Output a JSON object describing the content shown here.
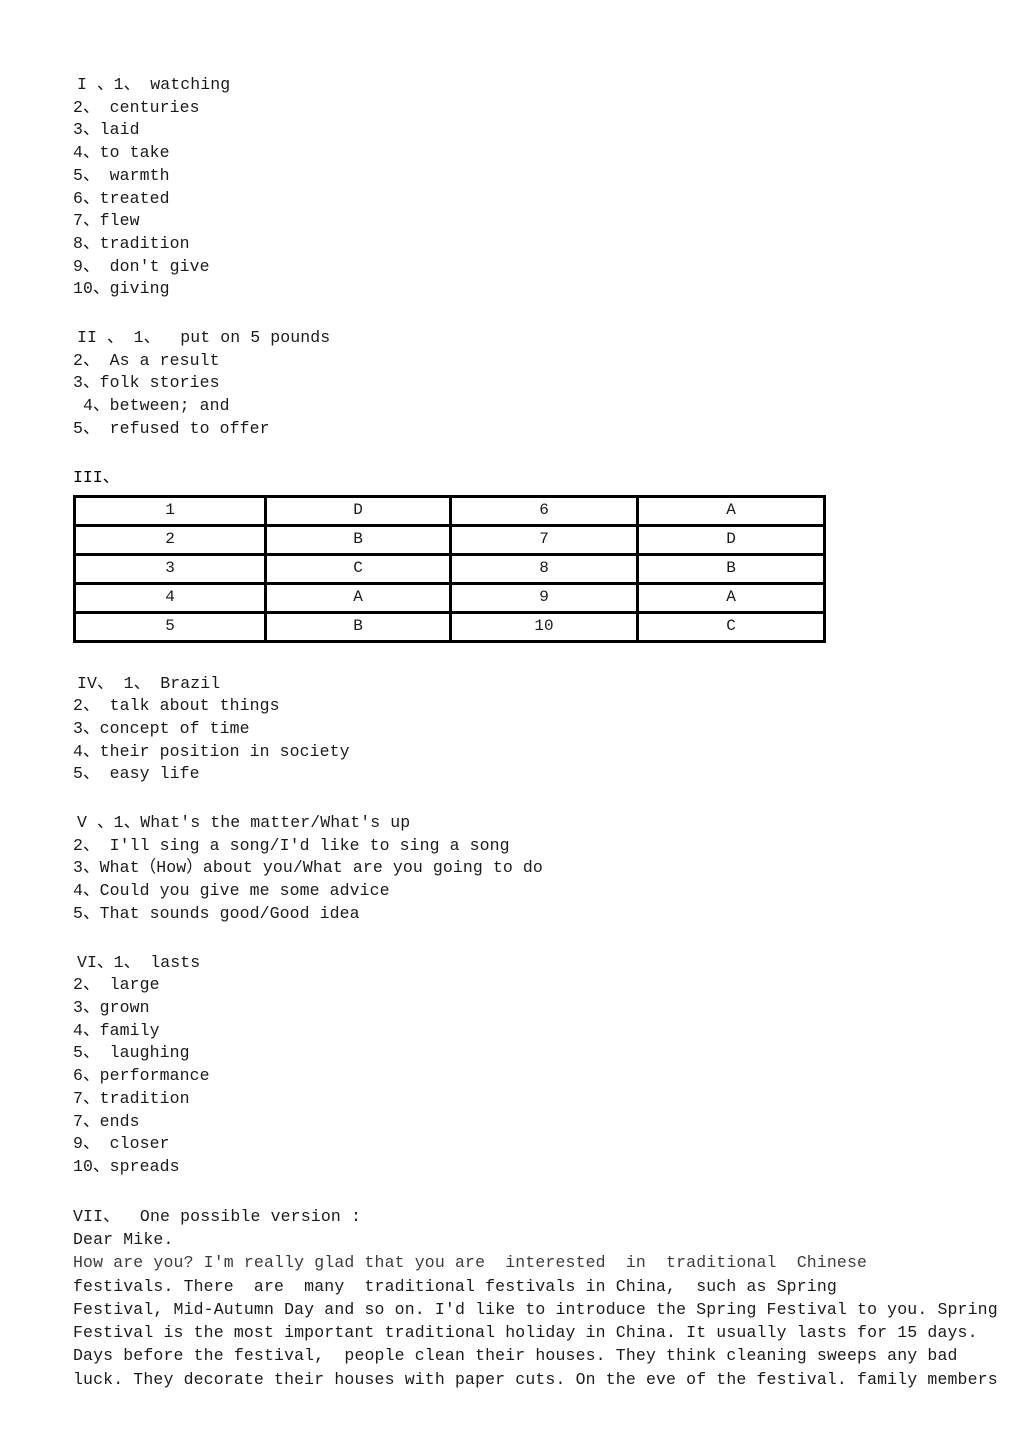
{
  "document": {
    "type": "answer-key",
    "language": "en-zh"
  },
  "sections": {
    "s1": {
      "marker": "I、",
      "lines": [
        "I 、1、 watching",
        "2、 centuries",
        "3、laid",
        "4、to take",
        "5、 warmth",
        "6、treated",
        "7、flew",
        "8、tradition",
        "9、 don't give",
        "10、giving"
      ]
    },
    "s2": {
      "marker": "II、",
      "lines": [
        "II 、 1、  put on 5 pounds",
        "2、 As a result",
        "3、folk stories",
        " 4、between; and",
        "5、 refused to offer"
      ]
    },
    "s3": {
      "marker": "III、",
      "table": {
        "rows": [
          [
            "1",
            "D",
            "6",
            "A"
          ],
          [
            "2",
            "B",
            "7",
            "D"
          ],
          [
            "3",
            "C",
            "8",
            "B"
          ],
          [
            "4",
            "A",
            "9",
            "A"
          ],
          [
            "5",
            "B",
            "10",
            "C"
          ]
        ]
      }
    },
    "s4": {
      "marker": "IV、",
      "lines": [
        "IV、 1、 Brazil",
        "2、 talk about things",
        "3、concept of time",
        "4、their position in society",
        "5、 easy life"
      ]
    },
    "s5": {
      "marker": "V、",
      "lines": [
        "V 、1、What's the matter/What's up",
        "2、 I'll sing a song/I'd like to sing a song",
        "3、What（How）about you/What are you going to do",
        "4、Could you give me some advice",
        "5、That sounds good/Good idea"
      ]
    },
    "s6": {
      "marker": "VI、",
      "lines": [
        "VI、1、 lasts",
        "2、 large",
        "3、grown",
        "4、family",
        "5、 laughing",
        "6、performance",
        "7、tradition",
        "7、ends",
        "9、 closer",
        "10、spreads"
      ]
    },
    "s7": {
      "marker": "VII、",
      "heading": "VII、  One possible version :",
      "salutation": "Dear Mike.",
      "body_lines": [
        "How are you? I'm really glad that you are  interested  in  traditional  Chinese",
        "festivals. There  are  many  traditional festivals in China,  such as Spring",
        "Festival, Mid-Autumn Day and so on. I'd like to introduce the Spring Festival to you. Spring",
        "Festival is the most important traditional holiday in China. It usually lasts for 15 days.",
        "Days before the festival,  people clean their houses. They think cleaning sweeps any bad",
        "luck. They decorate their houses with paper cuts. On the eve of the festival. family members"
      ]
    }
  },
  "colors": {
    "text": "#1a1a1a",
    "background": "#ffffff",
    "table_border": "#000000"
  }
}
